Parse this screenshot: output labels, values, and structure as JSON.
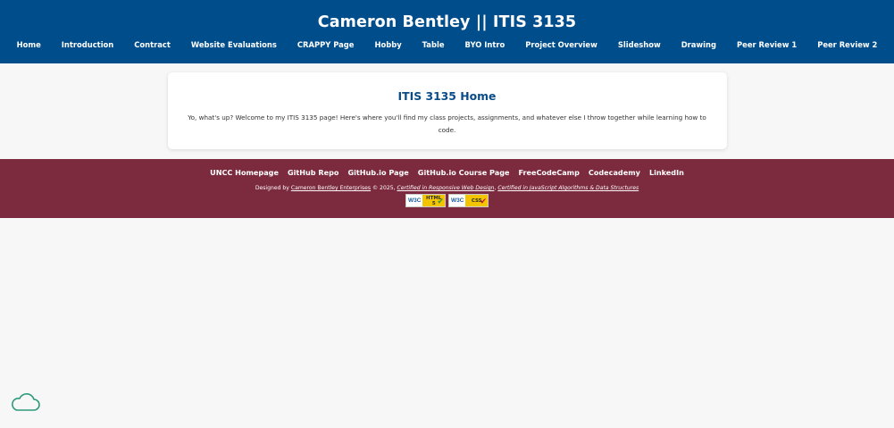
{
  "header": {
    "title": "Cameron Bentley || ITIS 3135",
    "nav": [
      "Home",
      "Introduction",
      "Contract",
      "Website Evaluations",
      "CRAPPY Page",
      "Hobby",
      "Table",
      "BYO Intro",
      "Project Overview",
      "Slideshow",
      "Drawing",
      "Peer Review 1",
      "Peer Review 2"
    ]
  },
  "main": {
    "heading": "ITIS 3135 Home",
    "intro": "Yo, what's up? Welcome to my ITIS 3135 page! Here's where you'll find my class projects, assignments, and whatever else I throw together while learning how to code."
  },
  "footer": {
    "links": [
      "UNCC Homepage",
      "GitHub Repo",
      "GitHub.io Page",
      "GitHub.io Course Page",
      "FreeCodeCamp",
      "Codecademy",
      "LinkedIn"
    ],
    "designed_by_prefix": "Designed by ",
    "designer_link": "Cameron Bentley Enterprises",
    "copyright": " © 2025, ",
    "cert_1": "Certified in Responsive Web Design",
    "separator": ", ",
    "cert_2": "Certified in JavaScript Algorithms & Data Structures",
    "badge_html": {
      "w3c": "W3C",
      "tag_line1": "HTML",
      "tag_line2": "5",
      "check": "✔"
    },
    "badge_css": {
      "w3c": "W3C",
      "tag_line1": "CSS",
      "check": "✔"
    }
  },
  "colors": {
    "header_bg": "#004d8c",
    "footer_bg": "#7c2a3e",
    "heading": "#0a4c87",
    "page_bg": "#f7f7f7",
    "cloud": "#2e9a7a"
  },
  "icons": {
    "cloud": "cloud-icon",
    "check": "check-icon"
  }
}
